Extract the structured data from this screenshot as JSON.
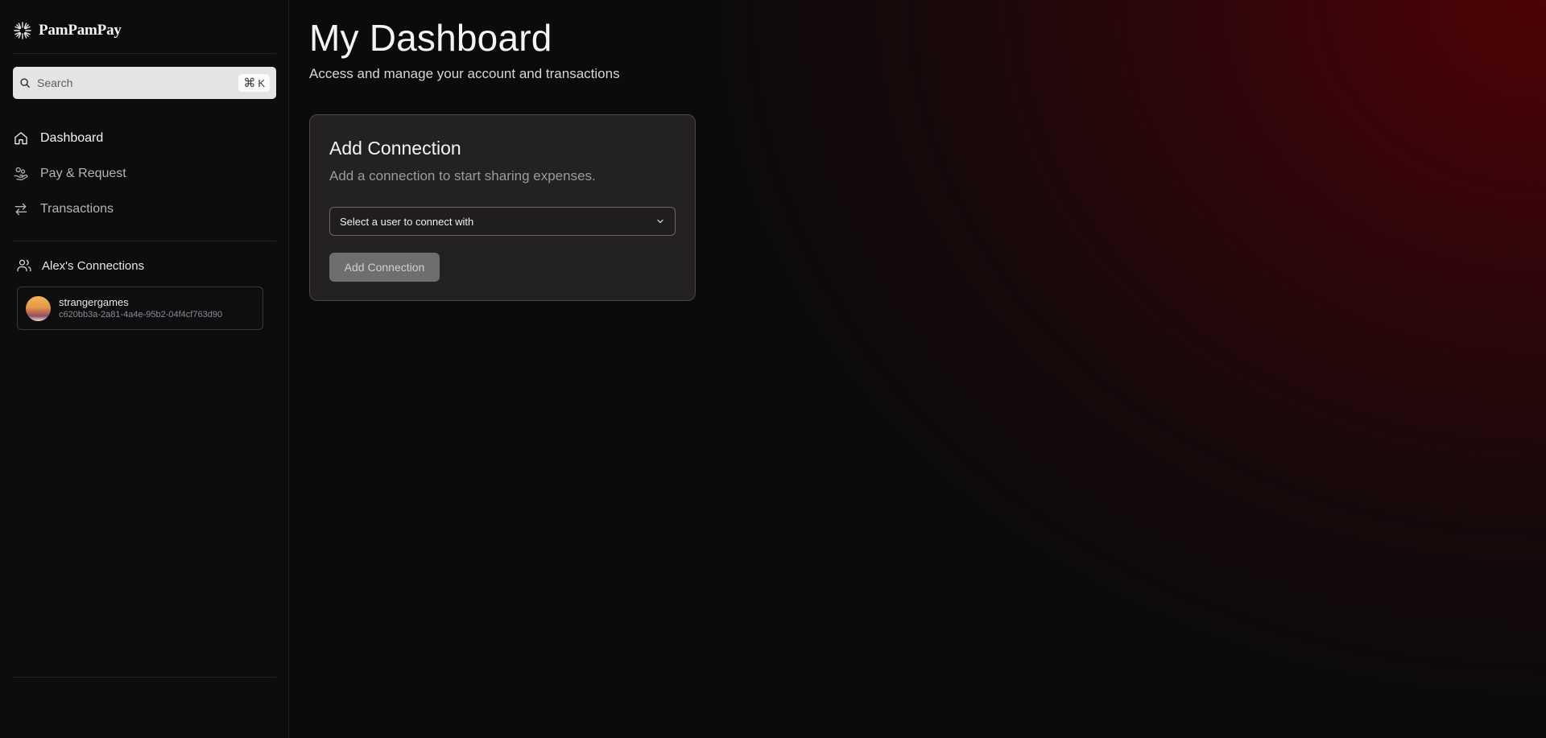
{
  "brand": {
    "name": "PamPamPay",
    "icon": "sunburst-icon"
  },
  "search": {
    "placeholder": "Search",
    "shortcut_symbol": "⌘",
    "shortcut_key": "K"
  },
  "nav": {
    "items": [
      {
        "label": "Dashboard",
        "icon": "home-icon",
        "active": true
      },
      {
        "label": "Pay & Request",
        "icon": "hand-coins-icon",
        "active": false
      },
      {
        "label": "Transactions",
        "icon": "arrows-swap-icon",
        "active": false
      }
    ]
  },
  "connections": {
    "title": "Alex's Connections",
    "icon": "users-icon",
    "items": [
      {
        "name": "strangergames",
        "id": "c620bb3a-2a81-4a4e-95b2-04f4cf763d90"
      }
    ]
  },
  "header": {
    "title": "My Dashboard",
    "subtitle": "Access and manage your account and transactions"
  },
  "add_connection_card": {
    "title": "Add Connection",
    "description": "Add a connection to start sharing expenses.",
    "select_placeholder": "Select a user to connect with",
    "button_label": "Add Connection"
  },
  "colors": {
    "background": "#0b0b0c",
    "accent_glow": "#4e0306",
    "card_bg": "#2c2828",
    "disabled_button": "#6e6e70"
  }
}
